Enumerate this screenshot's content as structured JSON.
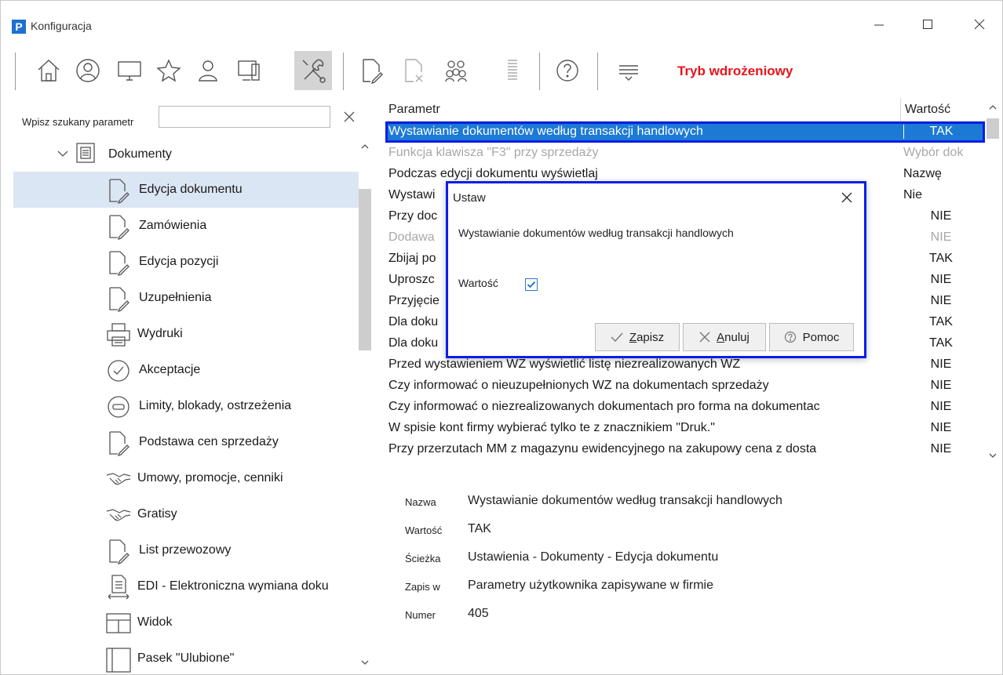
{
  "window": {
    "title": "Konfiguracja",
    "logo_letter": "P"
  },
  "toolbar": {
    "buttons": [
      "home-icon",
      "user-circle-icon",
      "monitor-icon",
      "star-icon",
      "person-icon",
      "workstation-icon",
      "tools-icon",
      "document-edit-icon",
      "document-remove-icon",
      "group-icon",
      "list-icon",
      "help-icon",
      "filter-icon"
    ],
    "active": "tools-icon",
    "mode_label": "Tryb wdrożeniowy",
    "mode_color": "#e8141c"
  },
  "search": {
    "label": "Wpisz szukany parametr",
    "value": "",
    "placeholder": ""
  },
  "tree": {
    "root_label": "Dokumenty",
    "items": [
      {
        "label": "Edycja dokumentu",
        "icon": "document-pen-icon",
        "selected": true
      },
      {
        "label": "Zamówienia",
        "icon": "document-pen-icon"
      },
      {
        "label": "Edycja pozycji",
        "icon": "document-pen-icon"
      },
      {
        "label": "Uzupełnienia",
        "icon": "document-pen-icon"
      },
      {
        "label": "Wydruki",
        "icon": "printer-icon"
      },
      {
        "label": "Akceptacje",
        "icon": "check-circle-icon"
      },
      {
        "label": "Limity, blokady, ostrzeżenia",
        "icon": "minus-circle-icon"
      },
      {
        "label": "Podstawa cen sprzedaży",
        "icon": "document-pen-icon"
      },
      {
        "label": "Umowy, promocje, cenniki",
        "icon": "handshake-icon"
      },
      {
        "label": "Gratisy",
        "icon": "handshake-icon"
      },
      {
        "label": "List przewozowy",
        "icon": "document-pen-icon"
      },
      {
        "label": "EDI - Elektroniczna wymiana doku",
        "icon": "document-exchange-icon"
      },
      {
        "label": "Widok",
        "icon": "layout-icon"
      },
      {
        "label": "Pasek \"Ulubione\"",
        "icon": "sidebar-layout-icon"
      }
    ]
  },
  "grid": {
    "col_param": "Parametr",
    "col_value": "Wartość",
    "rows": [
      {
        "param": "Wystawianie dokumentów według transakcji handlowych",
        "value": "TAK",
        "selected": true
      },
      {
        "param": "Funkcja klawisza \"F3\" przy sprzedaży",
        "value": "Wybór dok",
        "disabled": true
      },
      {
        "param": "Podczas edycji dokumentu wyświetlaj",
        "value": "Nazwę"
      },
      {
        "param": "Wystawi",
        "value": "Nie"
      },
      {
        "param": "Przy doc                                                                                           k pow",
        "value": "NIE"
      },
      {
        "param": "Dodawa",
        "value": "NIE",
        "disabled": true
      },
      {
        "param": "Zbijaj po                                                                                          wysta",
        "value": "TAK"
      },
      {
        "param": "Uproszc",
        "value": "NIE"
      },
      {
        "param": "Przyjęcie",
        "value": "NIE"
      },
      {
        "param": "Dla doku                                                                                         ego c",
        "value": "TAK"
      },
      {
        "param": "Dla doku                                                                                         wian",
        "value": "TAK"
      },
      {
        "param": "Przed wystawieniem WZ wyświetlić listę niezrealizowanych WZ",
        "value": "NIE"
      },
      {
        "param": "Czy informować o nieuzupełnionych WZ na dokumentach sprzedaży",
        "value": "NIE"
      },
      {
        "param": "Czy informować o niezrealizowanych dokumentach pro forma na dokumentac",
        "value": "NIE"
      },
      {
        "param": "W spisie kont firmy wybierać tylko te z znacznikiem \"Druk.\"",
        "value": "NIE"
      },
      {
        "param": "Przy przerzutach MM z magazynu ewidencyjnego na zakupowy cena z dosta",
        "value": "NIE"
      }
    ]
  },
  "details": [
    {
      "label": "Nazwa",
      "value": "Wystawianie dokumentów według transakcji handlowych"
    },
    {
      "label": "Wartość",
      "value": "TAK"
    },
    {
      "label": "Ścieżka",
      "value": "Ustawienia - Dokumenty - Edycja dokumentu"
    },
    {
      "label": "Zapis w",
      "value": "Parametry użytkownika zapisywane w firmie"
    },
    {
      "label": "Numer",
      "value": "405"
    }
  ],
  "dialog": {
    "title": "Ustaw",
    "description": "Wystawianie dokumentów według transakcji handlowych",
    "field_label": "Wartość",
    "checked": true,
    "save_label": "Zapisz",
    "cancel_label": "Anuluj",
    "help_label": "Pomoc",
    "border_color": "#0a1ee6"
  }
}
